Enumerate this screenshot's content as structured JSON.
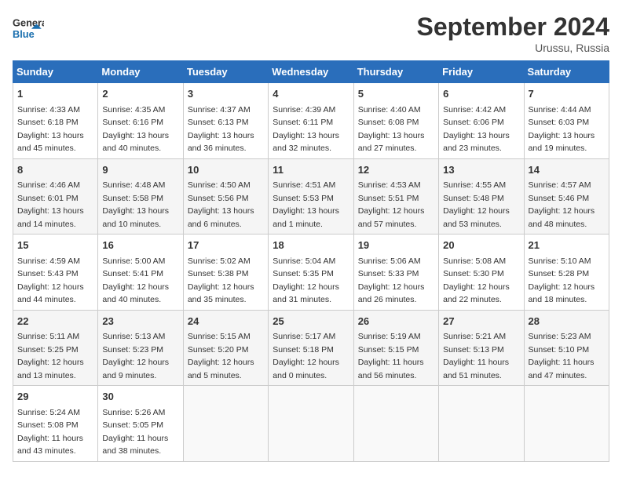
{
  "header": {
    "logo_general": "General",
    "logo_blue": "Blue",
    "month_title": "September 2024",
    "location": "Urussu, Russia"
  },
  "weekdays": [
    "Sunday",
    "Monday",
    "Tuesday",
    "Wednesday",
    "Thursday",
    "Friday",
    "Saturday"
  ],
  "weeks": [
    [
      {
        "day": "1",
        "sunrise": "Sunrise: 4:33 AM",
        "sunset": "Sunset: 6:18 PM",
        "daylight": "Daylight: 13 hours and 45 minutes."
      },
      {
        "day": "2",
        "sunrise": "Sunrise: 4:35 AM",
        "sunset": "Sunset: 6:16 PM",
        "daylight": "Daylight: 13 hours and 40 minutes."
      },
      {
        "day": "3",
        "sunrise": "Sunrise: 4:37 AM",
        "sunset": "Sunset: 6:13 PM",
        "daylight": "Daylight: 13 hours and 36 minutes."
      },
      {
        "day": "4",
        "sunrise": "Sunrise: 4:39 AM",
        "sunset": "Sunset: 6:11 PM",
        "daylight": "Daylight: 13 hours and 32 minutes."
      },
      {
        "day": "5",
        "sunrise": "Sunrise: 4:40 AM",
        "sunset": "Sunset: 6:08 PM",
        "daylight": "Daylight: 13 hours and 27 minutes."
      },
      {
        "day": "6",
        "sunrise": "Sunrise: 4:42 AM",
        "sunset": "Sunset: 6:06 PM",
        "daylight": "Daylight: 13 hours and 23 minutes."
      },
      {
        "day": "7",
        "sunrise": "Sunrise: 4:44 AM",
        "sunset": "Sunset: 6:03 PM",
        "daylight": "Daylight: 13 hours and 19 minutes."
      }
    ],
    [
      {
        "day": "8",
        "sunrise": "Sunrise: 4:46 AM",
        "sunset": "Sunset: 6:01 PM",
        "daylight": "Daylight: 13 hours and 14 minutes."
      },
      {
        "day": "9",
        "sunrise": "Sunrise: 4:48 AM",
        "sunset": "Sunset: 5:58 PM",
        "daylight": "Daylight: 13 hours and 10 minutes."
      },
      {
        "day": "10",
        "sunrise": "Sunrise: 4:50 AM",
        "sunset": "Sunset: 5:56 PM",
        "daylight": "Daylight: 13 hours and 6 minutes."
      },
      {
        "day": "11",
        "sunrise": "Sunrise: 4:51 AM",
        "sunset": "Sunset: 5:53 PM",
        "daylight": "Daylight: 13 hours and 1 minute."
      },
      {
        "day": "12",
        "sunrise": "Sunrise: 4:53 AM",
        "sunset": "Sunset: 5:51 PM",
        "daylight": "Daylight: 12 hours and 57 minutes."
      },
      {
        "day": "13",
        "sunrise": "Sunrise: 4:55 AM",
        "sunset": "Sunset: 5:48 PM",
        "daylight": "Daylight: 12 hours and 53 minutes."
      },
      {
        "day": "14",
        "sunrise": "Sunrise: 4:57 AM",
        "sunset": "Sunset: 5:46 PM",
        "daylight": "Daylight: 12 hours and 48 minutes."
      }
    ],
    [
      {
        "day": "15",
        "sunrise": "Sunrise: 4:59 AM",
        "sunset": "Sunset: 5:43 PM",
        "daylight": "Daylight: 12 hours and 44 minutes."
      },
      {
        "day": "16",
        "sunrise": "Sunrise: 5:00 AM",
        "sunset": "Sunset: 5:41 PM",
        "daylight": "Daylight: 12 hours and 40 minutes."
      },
      {
        "day": "17",
        "sunrise": "Sunrise: 5:02 AM",
        "sunset": "Sunset: 5:38 PM",
        "daylight": "Daylight: 12 hours and 35 minutes."
      },
      {
        "day": "18",
        "sunrise": "Sunrise: 5:04 AM",
        "sunset": "Sunset: 5:35 PM",
        "daylight": "Daylight: 12 hours and 31 minutes."
      },
      {
        "day": "19",
        "sunrise": "Sunrise: 5:06 AM",
        "sunset": "Sunset: 5:33 PM",
        "daylight": "Daylight: 12 hours and 26 minutes."
      },
      {
        "day": "20",
        "sunrise": "Sunrise: 5:08 AM",
        "sunset": "Sunset: 5:30 PM",
        "daylight": "Daylight: 12 hours and 22 minutes."
      },
      {
        "day": "21",
        "sunrise": "Sunrise: 5:10 AM",
        "sunset": "Sunset: 5:28 PM",
        "daylight": "Daylight: 12 hours and 18 minutes."
      }
    ],
    [
      {
        "day": "22",
        "sunrise": "Sunrise: 5:11 AM",
        "sunset": "Sunset: 5:25 PM",
        "daylight": "Daylight: 12 hours and 13 minutes."
      },
      {
        "day": "23",
        "sunrise": "Sunrise: 5:13 AM",
        "sunset": "Sunset: 5:23 PM",
        "daylight": "Daylight: 12 hours and 9 minutes."
      },
      {
        "day": "24",
        "sunrise": "Sunrise: 5:15 AM",
        "sunset": "Sunset: 5:20 PM",
        "daylight": "Daylight: 12 hours and 5 minutes."
      },
      {
        "day": "25",
        "sunrise": "Sunrise: 5:17 AM",
        "sunset": "Sunset: 5:18 PM",
        "daylight": "Daylight: 12 hours and 0 minutes."
      },
      {
        "day": "26",
        "sunrise": "Sunrise: 5:19 AM",
        "sunset": "Sunset: 5:15 PM",
        "daylight": "Daylight: 11 hours and 56 minutes."
      },
      {
        "day": "27",
        "sunrise": "Sunrise: 5:21 AM",
        "sunset": "Sunset: 5:13 PM",
        "daylight": "Daylight: 11 hours and 51 minutes."
      },
      {
        "day": "28",
        "sunrise": "Sunrise: 5:23 AM",
        "sunset": "Sunset: 5:10 PM",
        "daylight": "Daylight: 11 hours and 47 minutes."
      }
    ],
    [
      {
        "day": "29",
        "sunrise": "Sunrise: 5:24 AM",
        "sunset": "Sunset: 5:08 PM",
        "daylight": "Daylight: 11 hours and 43 minutes."
      },
      {
        "day": "30",
        "sunrise": "Sunrise: 5:26 AM",
        "sunset": "Sunset: 5:05 PM",
        "daylight": "Daylight: 11 hours and 38 minutes."
      },
      null,
      null,
      null,
      null,
      null
    ]
  ]
}
